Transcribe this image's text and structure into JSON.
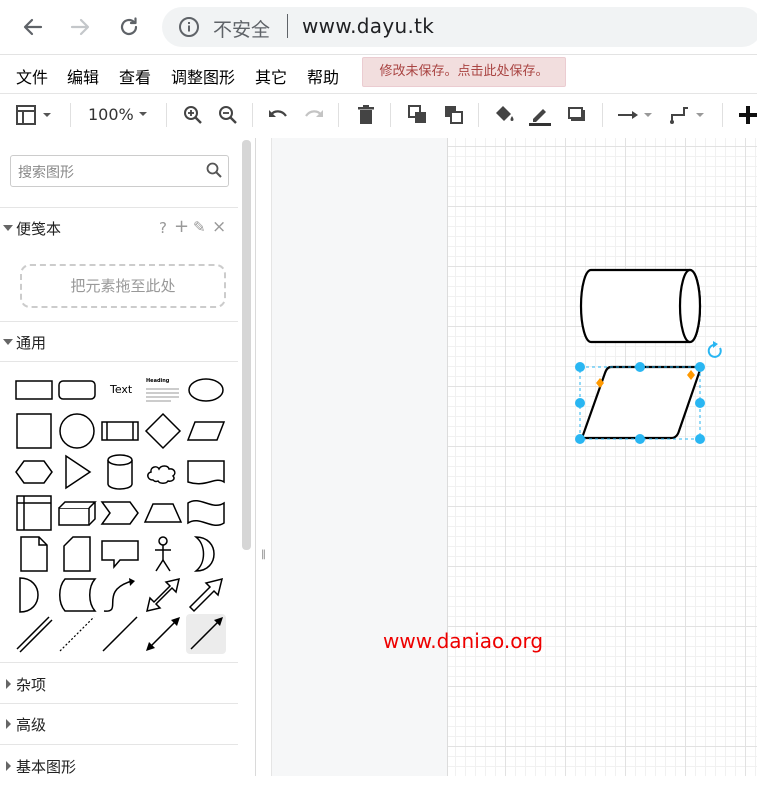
{
  "browser": {
    "security_text": "不安全",
    "url": "www.dayu.tk"
  },
  "menu": {
    "items": [
      "文件",
      "编辑",
      "查看",
      "调整图形",
      "其它",
      "帮助"
    ],
    "unsaved_notice": "修改未保存。点击此处保存。"
  },
  "toolbar": {
    "zoom": "100%"
  },
  "sidebar": {
    "search_placeholder": "搜索图形",
    "sections": [
      {
        "title": "便笺本",
        "expanded": true
      },
      {
        "title": "通用",
        "expanded": true
      },
      {
        "title": "杂项",
        "expanded": false
      },
      {
        "title": "高级",
        "expanded": false
      },
      {
        "title": "基本图形",
        "expanded": false
      }
    ],
    "scratchpad_actions": [
      "?",
      "+",
      "✎",
      "×"
    ],
    "drop_zone_text": "把元素拖至此处",
    "shape_text_label": "Text",
    "shape_heading_label": "Heading"
  },
  "canvas": {
    "watermark": "www.daniao.org"
  },
  "colors": {
    "accent": "#29b6f2",
    "handle_orange": "#ff9900",
    "unsaved_bg": "#f2dede",
    "unsaved_text": "#a94442",
    "watermark": "#e00000"
  }
}
